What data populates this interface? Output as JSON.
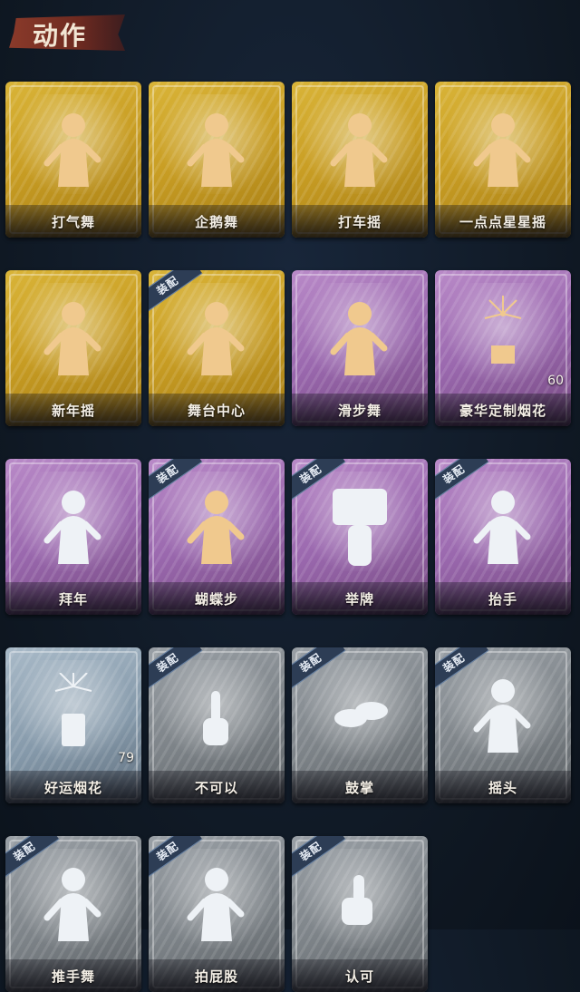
{
  "header": {
    "title": "动作"
  },
  "colors": {
    "gold": "#c99e24",
    "purple": "#9a68ae",
    "blue": "#8599aa",
    "gray": "#7c8287",
    "figure_gold": "#f0c98e",
    "figure_white": "#eef2f6"
  },
  "items": [
    {
      "label": "打气舞",
      "tier": "gold",
      "equipped": false,
      "icon": "dance-figure-icon"
    },
    {
      "label": "企鹅舞",
      "tier": "gold",
      "equipped": false,
      "icon": "dance-figure-icon"
    },
    {
      "label": "打车摇",
      "tier": "gold",
      "equipped": false,
      "icon": "dance-figure-icon"
    },
    {
      "label": "一点点星星摇",
      "tier": "gold",
      "equipped": false,
      "icon": "dance-figure-icon"
    },
    {
      "label": "新年摇",
      "tier": "gold",
      "equipped": false,
      "icon": "dance-figure-icon"
    },
    {
      "label": "舞台中心",
      "tier": "gold",
      "equipped": true,
      "badge": "装配",
      "icon": "dance-figure-icon"
    },
    {
      "label": "滑步舞",
      "tier": "purple",
      "equipped": false,
      "icon": "dance-figure-icon"
    },
    {
      "label": "豪华定制烟花",
      "tier": "purple",
      "equipped": false,
      "count": "60",
      "icon": "firework-box-icon"
    },
    {
      "label": "拜年",
      "tier": "purple",
      "equipped": false,
      "icon": "bow-figure-icon"
    },
    {
      "label": "蝴蝶步",
      "tier": "purple",
      "equipped": true,
      "badge": "装配",
      "icon": "point-figure-icon"
    },
    {
      "label": "举牌",
      "tier": "purple",
      "equipped": true,
      "badge": "装配",
      "icon": "sign-holding-figure-icon"
    },
    {
      "label": "抬手",
      "tier": "purple",
      "equipped": true,
      "badge": "装配",
      "icon": "raise-hand-figure-icon"
    },
    {
      "label": "好运烟花",
      "tier": "blue",
      "equipped": false,
      "count": "79",
      "icon": "firework-can-icon"
    },
    {
      "label": "不可以",
      "tier": "gray",
      "equipped": true,
      "badge": "装配",
      "icon": "finger-wag-icon"
    },
    {
      "label": "鼓掌",
      "tier": "gray",
      "equipped": true,
      "badge": "装配",
      "icon": "clap-hands-icon"
    },
    {
      "label": "摇头",
      "tier": "gray",
      "equipped": true,
      "badge": "装配",
      "icon": "head-shake-figure-icon"
    },
    {
      "label": "推手舞",
      "tier": "gray",
      "equipped": true,
      "badge": "装配",
      "icon": "push-dance-figure-icon"
    },
    {
      "label": "拍屁股",
      "tier": "gray",
      "equipped": true,
      "badge": "装配",
      "icon": "butt-slap-figure-icon"
    },
    {
      "label": "认可",
      "tier": "gray",
      "equipped": true,
      "badge": "装配",
      "icon": "thumbs-up-icon"
    }
  ]
}
